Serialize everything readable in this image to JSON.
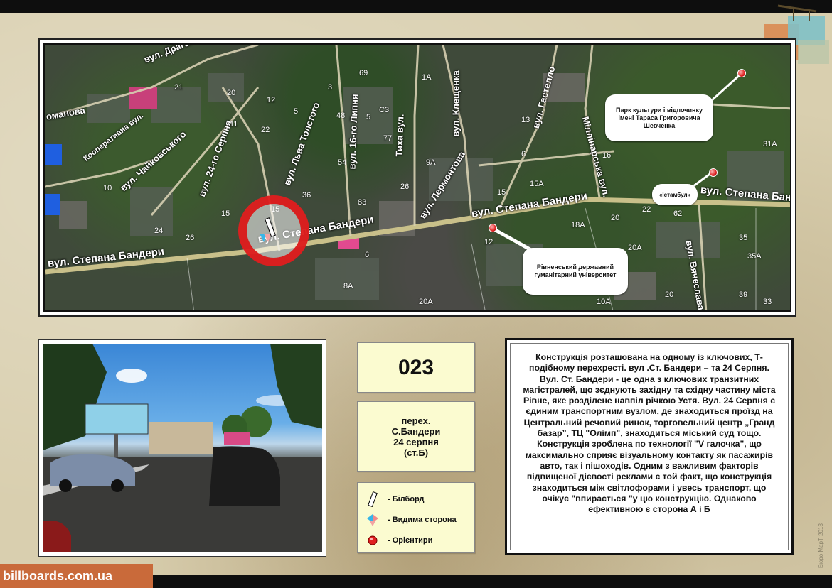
{
  "map": {
    "streets": [
      {
        "name": "вул. Драгоманова"
      },
      {
        "name": "оманова"
      },
      {
        "name": "Кооперативна вул."
      },
      {
        "name": "вул. Чайковського"
      },
      {
        "name": "вул. 24-го Серпня"
      },
      {
        "name": "вул. Льва Толстого"
      },
      {
        "name": "вул. 16-го Липня"
      },
      {
        "name": "Тиха вул."
      },
      {
        "name": "вул. Клещенка"
      },
      {
        "name": "вул. Лермонтова"
      },
      {
        "name": "вул. Гастелло"
      },
      {
        "name": "Міллінарська вул."
      },
      {
        "name": "вул. Степана Бандери"
      },
      {
        "name": "вул. Степана Бандери"
      },
      {
        "name": "вул. Степана Бандери"
      },
      {
        "name": "вул. Степана Бандери"
      },
      {
        "name": "вул. Вячеслава"
      }
    ],
    "house_numbers": [
      {
        "num": "21"
      },
      {
        "num": "20"
      },
      {
        "num": "12"
      },
      {
        "num": "3"
      },
      {
        "num": "69"
      },
      {
        "num": "1А"
      },
      {
        "num": "11"
      },
      {
        "num": "5"
      },
      {
        "num": "48"
      },
      {
        "num": "5"
      },
      {
        "num": "C3"
      },
      {
        "num": "77"
      },
      {
        "num": "22"
      },
      {
        "num": "54"
      },
      {
        "num": "10"
      },
      {
        "num": "15"
      },
      {
        "num": "36"
      },
      {
        "num": "26"
      },
      {
        "num": "83"
      },
      {
        "num": "24"
      },
      {
        "num": "26"
      },
      {
        "num": "15"
      },
      {
        "num": "6"
      },
      {
        "num": "8А"
      },
      {
        "num": "20А"
      },
      {
        "num": "13"
      },
      {
        "num": "9А"
      },
      {
        "num": "6"
      },
      {
        "num": "16"
      },
      {
        "num": "15А"
      },
      {
        "num": "15"
      },
      {
        "num": "12"
      },
      {
        "num": "18А"
      },
      {
        "num": "20"
      },
      {
        "num": "22"
      },
      {
        "num": "62"
      },
      {
        "num": "20А"
      },
      {
        "num": "10А"
      },
      {
        "num": "31А"
      },
      {
        "num": "35"
      },
      {
        "num": "35А"
      },
      {
        "num": "39"
      },
      {
        "num": "33"
      },
      {
        "num": "20"
      }
    ],
    "landmarks": [
      {
        "label": "Парк культури і відпочинку імені Тараса Григоровича Шевченка"
      },
      {
        "label": "«Істамбул»"
      },
      {
        "label": "Рівненський державний гуманітарний університет"
      }
    ]
  },
  "info": {
    "code": "023",
    "address_lines": [
      "перех.",
      "С.Бандери",
      "24 серпня",
      "(ст.Б)"
    ]
  },
  "legend": [
    {
      "icon": "billboard-icon",
      "label": "- Білборд"
    },
    {
      "icon": "visible-side-icon",
      "label": "- Видима сторона"
    },
    {
      "icon": "landmark-icon",
      "label": "- Орієнтири"
    }
  ],
  "description": "Конструкція розташована на одному із ключових, Т-подібному перехресті. вул .Ст. Бандери  – та 24 Серпня. Вул. Ст. Бандери - це одна з ключових транзитних магістралей, що зєднують західну та східну частину міста Рівне, яке розділене навпіл річкою Устя.  Вул. 24 Серпня є єдиним транспортним вузлом, де знаходиться проїзд на Центральний речовий ринок, торговельний центр „Гранд базар”, ТЦ \"Олімп\", знаходиться міський суд тощо. Конструкція зроблена по технології \"V галочка\", що максимально сприяє візуальному контакту як пасажирів авто, так і пішоходів. Одним з важливим факторів підвищеної дієвості реклами є той факт, що конструкція знаходиться між світлофорами і увесь транспорт, що очікує \"впирається \"у цю конструкцію. Однаково ефективною є сторона А і Б",
  "footer": {
    "site": "billboards.com.ua",
    "credit": "Бюро МарТ 2013"
  },
  "colors": {
    "ring": "#dc1414",
    "box_fill": "#fbfbd0",
    "url_bar": "#c96a3a",
    "road": "#c9c08a"
  }
}
